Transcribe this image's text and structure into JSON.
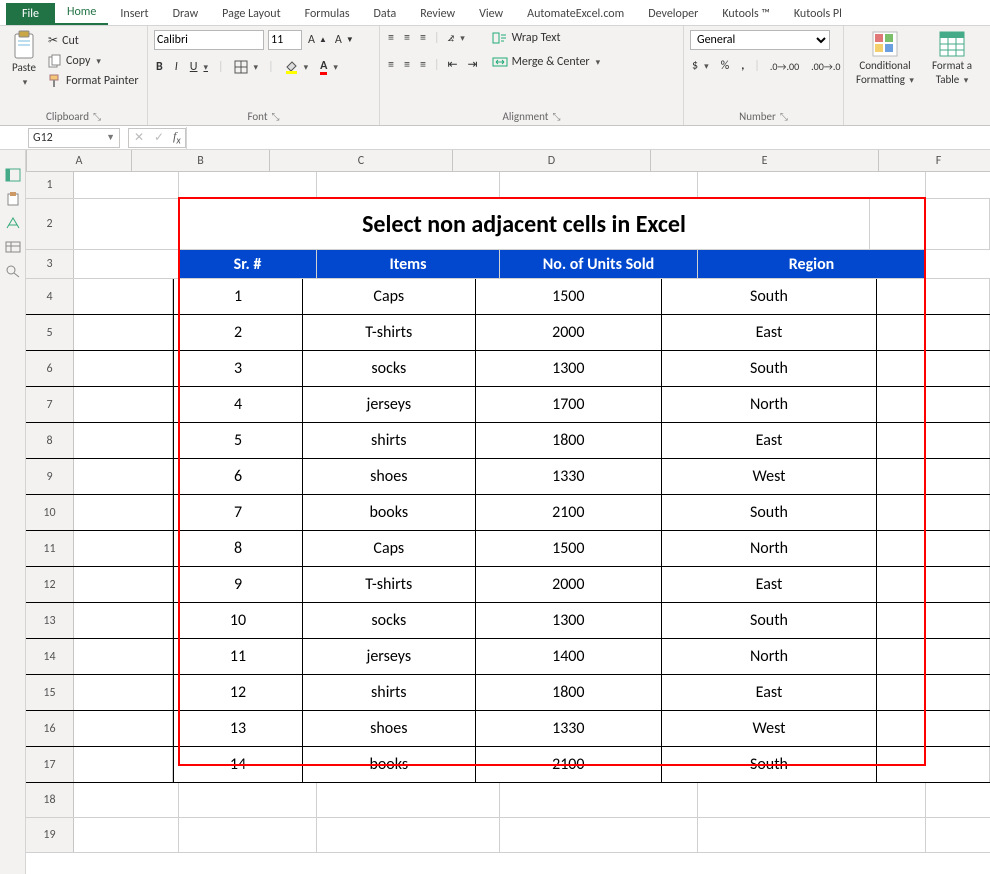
{
  "tabs": {
    "file": "File",
    "home": "Home",
    "insert": "Insert",
    "draw": "Draw",
    "pagelayout": "Page Layout",
    "formulas": "Formulas",
    "data": "Data",
    "review": "Review",
    "view": "View",
    "automate": "AutomateExcel.com",
    "developer": "Developer",
    "kutools": "Kutools ™",
    "kutoolsplus": "Kutools Pl"
  },
  "clipboard": {
    "paste": "Paste",
    "cut": "Cut",
    "copy": "Copy",
    "formatpainter": "Format Painter",
    "label": "Clipboard"
  },
  "font": {
    "name": "Calibri",
    "size": "11",
    "bold": "B",
    "italic": "I",
    "underline": "U",
    "label": "Font"
  },
  "alignment": {
    "wrap": "Wrap Text",
    "merge": "Merge & Center",
    "label": "Alignment"
  },
  "number": {
    "format": "General",
    "label": "Number"
  },
  "styles": {
    "conditional": "Conditional",
    "formatting": "Formatting",
    "formatas": "Format a",
    "table": "Table",
    "label": ""
  },
  "namebox": {
    "ref": "G12"
  },
  "columns": [
    "A",
    "B",
    "C",
    "D",
    "E",
    "F"
  ],
  "sheet": {
    "title": "Select non adjacent cells in Excel",
    "headers": {
      "sr": "Sr. #",
      "items": "Items",
      "units": "No. of Units Sold",
      "region": "Region"
    },
    "rows": [
      {
        "sr": "1",
        "items": "Caps",
        "units": "1500",
        "region": "South"
      },
      {
        "sr": "2",
        "items": "T-shirts",
        "units": "2000",
        "region": "East"
      },
      {
        "sr": "3",
        "items": "socks",
        "units": "1300",
        "region": "South"
      },
      {
        "sr": "4",
        "items": "jerseys",
        "units": "1700",
        "region": "North"
      },
      {
        "sr": "5",
        "items": "shirts",
        "units": "1800",
        "region": "East"
      },
      {
        "sr": "6",
        "items": "shoes",
        "units": "1330",
        "region": "West"
      },
      {
        "sr": "7",
        "items": "books",
        "units": "2100",
        "region": "South"
      },
      {
        "sr": "8",
        "items": "Caps",
        "units": "1500",
        "region": "North"
      },
      {
        "sr": "9",
        "items": "T-shirts",
        "units": "2000",
        "region": "East"
      },
      {
        "sr": "10",
        "items": "socks",
        "units": "1300",
        "region": "South"
      },
      {
        "sr": "11",
        "items": "jerseys",
        "units": "1400",
        "region": "North"
      },
      {
        "sr": "12",
        "items": "shirts",
        "units": "1800",
        "region": "East"
      },
      {
        "sr": "13",
        "items": "shoes",
        "units": "1330",
        "region": "West"
      },
      {
        "sr": "14",
        "items": "books",
        "units": "2100",
        "region": "South"
      }
    ]
  }
}
